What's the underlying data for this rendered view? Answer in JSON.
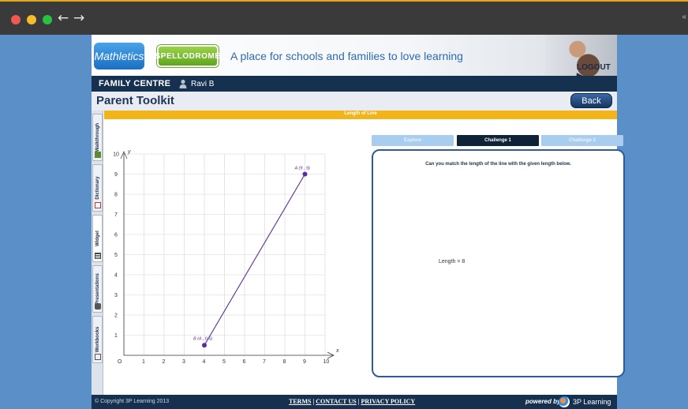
{
  "browser": {
    "back_icon": "←",
    "forward_icon": "→",
    "right_fragment": "«"
  },
  "banner": {
    "mathletics": "Mathletics",
    "spellodrome": "SPELLODROME",
    "tagline": "A place for schools and families to love learning",
    "logout": "LOGOUT"
  },
  "family_bar": {
    "title": "FAMILY CENTRE",
    "user": "Ravi B"
  },
  "toolkit": {
    "title": "Parent Toolkit",
    "back": "Back"
  },
  "side_tabs": [
    "Walkthrough",
    "Dictionary",
    "Widget",
    "Presentations",
    "Workbooks"
  ],
  "widget": {
    "title": "Length of Line",
    "tabs": [
      "Explore",
      "Challenge 1",
      "Challenge 2"
    ],
    "active_tab": "Challenge 1",
    "question": "Can you match the length of the line with the given length below.",
    "length_text": "Length = 8"
  },
  "graph": {
    "x_axis_label": "x",
    "y_axis_label": "y",
    "origin_label": "O",
    "x_ticks": [
      "1",
      "2",
      "3",
      "4",
      "5",
      "6",
      "7",
      "8",
      "9",
      "10"
    ],
    "y_ticks": [
      "1",
      "2",
      "3",
      "4",
      "5",
      "6",
      "7",
      "8",
      "9",
      "10"
    ],
    "point_a": {
      "label": "A (9 , 9)",
      "x": 9,
      "y": 9
    },
    "point_b": {
      "label": "B (4 , 0.5)",
      "x": 4,
      "y": 0.5
    },
    "line_color": "#5a2ca0"
  },
  "footer": {
    "copyright": "© Copyright 3P Learning 2013",
    "terms": "TERMS",
    "contact": "CONTACT US",
    "privacy": "PRIVACY POLICY",
    "powered": "powered by:",
    "brand": "3P Learning"
  },
  "colors": {
    "accent_yellow": "#f2b41b",
    "navy": "#16304f",
    "tab_active": "#0f2238",
    "tab_inactive": "#a9cdee"
  }
}
